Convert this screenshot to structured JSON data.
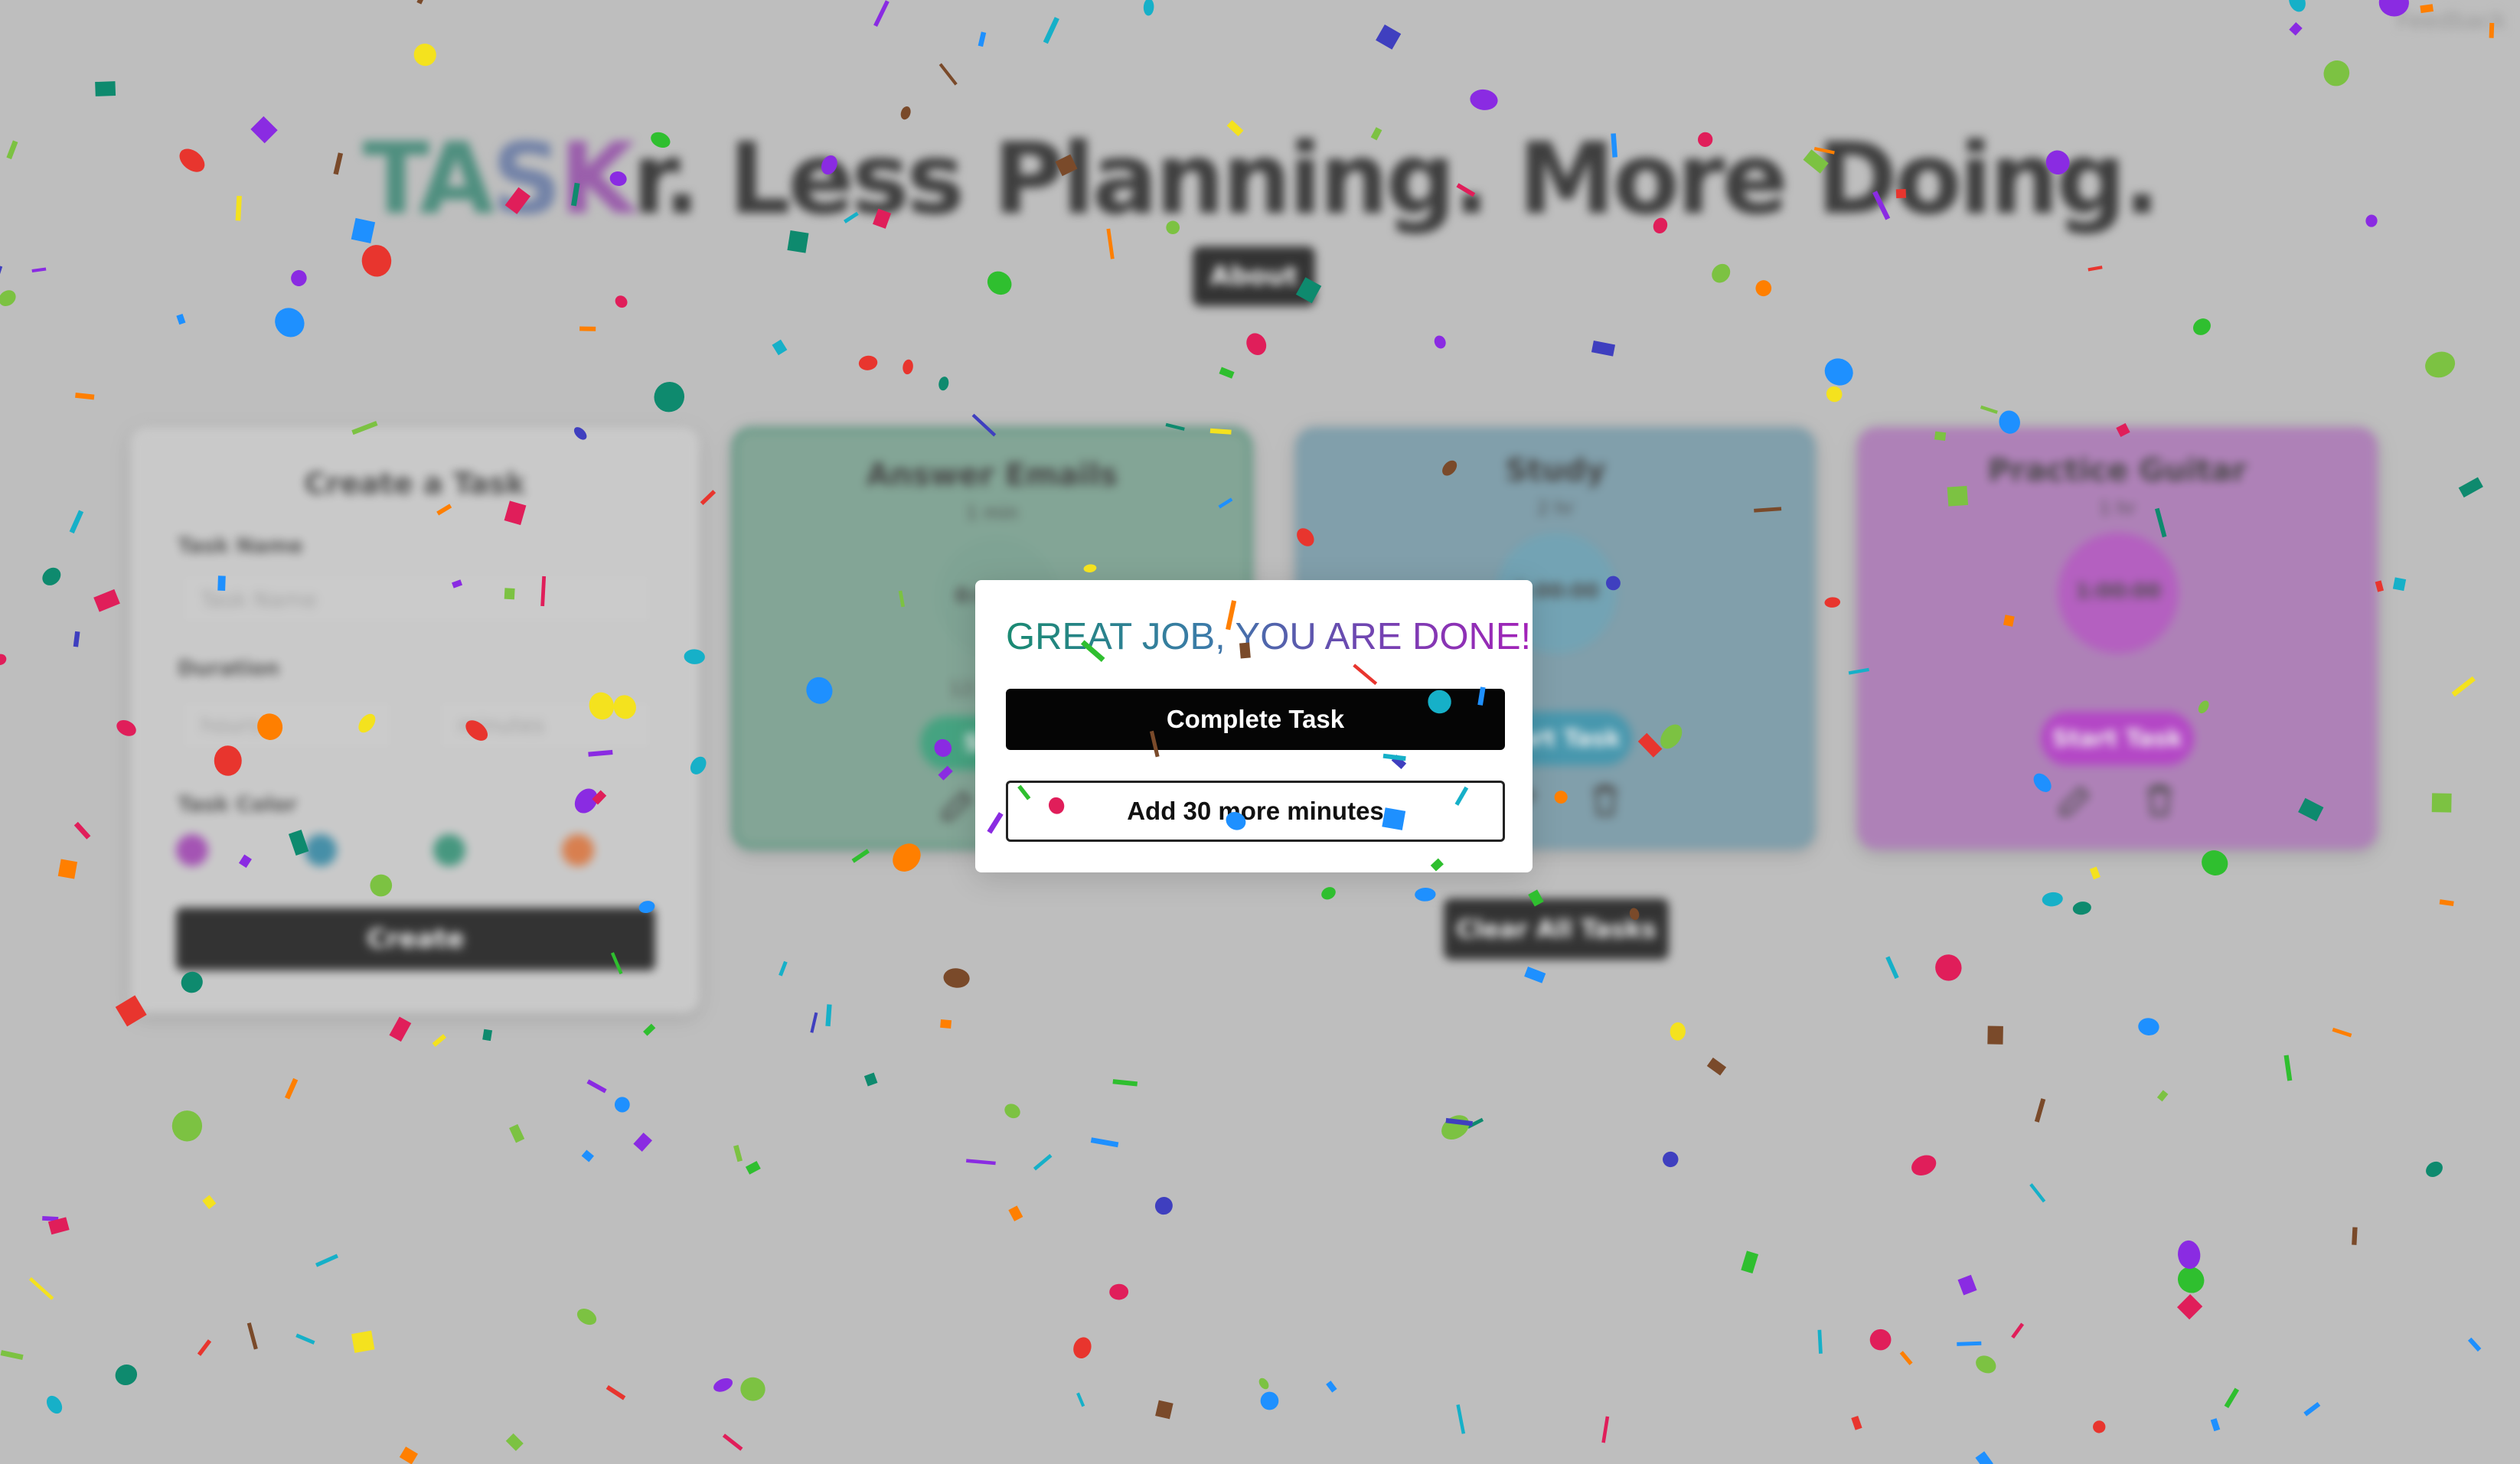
{
  "header": {
    "feedback_label": "Feedback",
    "title_brand_parts": [
      "TA",
      "S",
      "K"
    ],
    "title_rest": "r. Less Planning. More Doing.",
    "about_label": "About"
  },
  "create_task": {
    "title": "Create a Task",
    "task_name_label": "Task Name",
    "task_name_placeholder": "Task Name",
    "duration_label": "Duration",
    "hours_placeholder": "hours",
    "minutes_placeholder": "minutes",
    "task_color_label": "Task Color",
    "color_options": [
      "#9b30b0",
      "#1e7fa0",
      "#1e8a6a",
      "#e06a2a"
    ],
    "create_label": "Create"
  },
  "tasks": [
    {
      "name": "Answer Emails",
      "duration": "1 min",
      "timer": "0:00:00",
      "ends_at": "12:37 PM",
      "start_label": "Start",
      "color": "#6f9c88",
      "ring_color": "#6a9a86",
      "button_color": "#1d9a6c"
    },
    {
      "name": "Study",
      "duration": "2 hr",
      "timer": "2:00:00",
      "ends_at": "",
      "start_label": "Start Task",
      "color": "#6c94a4",
      "ring_color": "#5a9ab0",
      "button_color": "#1f8aa8"
    },
    {
      "name": "Practice Guitar",
      "duration": "1 hr",
      "timer": "1:00:00",
      "ends_at": "",
      "start_label": "Start Task",
      "color": "#a96db5",
      "ring_color": "#b040c0",
      "button_color": "#b01ec8"
    }
  ],
  "clear_all_label": "Clear All Tasks",
  "modal": {
    "title": "GREAT JOB, YOU ARE DONE!",
    "complete_label": "Complete Task",
    "add_time_label": "Add 30 more minutes"
  },
  "confetti_colors": [
    "#f4e21e",
    "#1e90ff",
    "#e8352e",
    "#8a2be2",
    "#2fbf2f",
    "#ff7f00",
    "#16b0c8",
    "#7cc242",
    "#e01e5a",
    "#3f3fbf",
    "#7a4a2a",
    "#0e8a6e"
  ]
}
